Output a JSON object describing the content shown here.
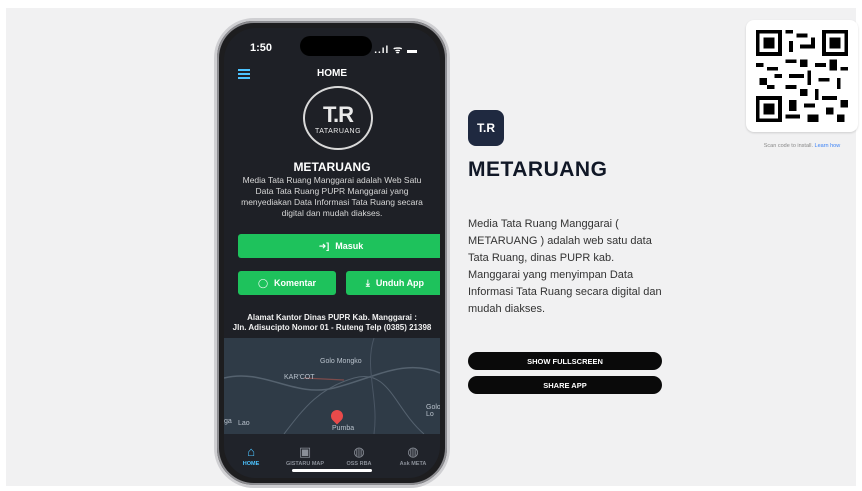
{
  "phone": {
    "time": "1:50",
    "signal": "..ıl ᯤ ▬",
    "header_title": "HOME",
    "logo_big": "T.R",
    "logo_small": "TATARUANG",
    "app_name": "METARUANG",
    "description": "Media Tata Ruang Manggarai adalah Web Satu Data Tata Ruang PUPR Manggarai yang menyediakan Data Informasi Tata Ruang secara digital dan mudah diakses.",
    "btn_masuk": "Masuk",
    "btn_komentar": "Komentar",
    "btn_unduh": "Unduh App",
    "address_line1": "Alamat Kantor Dinas PUPR Kab. Manggarai :",
    "address_line2": "Jln. Adisucipto Nomor 01 - Ruteng Telp (0385) 21398",
    "map_labels": {
      "a": "Golo Mongko",
      "b": "KAR'COT",
      "c": "Golo Lo",
      "d": "ga",
      "e": "Lao",
      "f": "Pumba"
    },
    "tabs": [
      {
        "label": "HOME",
        "icon": "home-icon"
      },
      {
        "label": "GISTARU MAP",
        "icon": "map-icon"
      },
      {
        "label": "OSS RBA",
        "icon": "globe-icon"
      },
      {
        "label": "Ask META",
        "icon": "chat-icon"
      }
    ]
  },
  "app": {
    "icon_text": "T.R",
    "title": "METARUANG",
    "description": "Media Tata Ruang Manggarai ( METARUANG ) adalah web satu data Tata Ruang, dinas PUPR kab. Manggarai yang menyimpan Data Informasi Tata Ruang secara digital dan mudah diakses.",
    "show_fullscreen": "SHOW FULLSCREEN",
    "share_app": "SHARE APP"
  },
  "qr": {
    "caption": "Scan code to install.",
    "learn_how": "Learn how"
  },
  "colors": {
    "accent_green": "#1ec25c",
    "accent_blue": "#4cc3ff",
    "dark": "#0a0a0a"
  }
}
